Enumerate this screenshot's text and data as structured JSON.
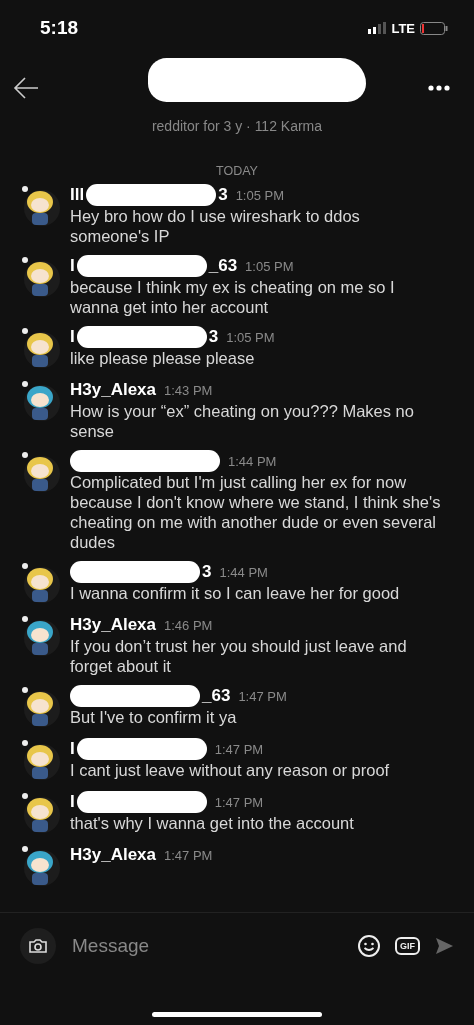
{
  "status_bar": {
    "time": "5:18",
    "network": "LTE"
  },
  "header": {
    "subtitle": "redditor for 3 y · 112 Karma"
  },
  "date_divider": "TODAY",
  "messages": [
    {
      "author_start": "Ill",
      "author_end": "3",
      "redacted": true,
      "color": "#e8c64a",
      "time": "1:05 PM",
      "text": "Hey bro how do I use wireshark to ddos someone's IP"
    },
    {
      "author_start": "I",
      "author_end": "_63",
      "redacted": true,
      "color": "#e8c64a",
      "time": "1:05 PM",
      "text": "because I think my ex is cheating on me so I wanna get into her account"
    },
    {
      "author_start": "I",
      "author_end": "3",
      "redacted": true,
      "color": "#e8c64a",
      "time": "1:05 PM",
      "text": "like please please please"
    },
    {
      "author_start": "H3y_Alexa",
      "redacted": false,
      "color": "#3aa6c9",
      "time": "1:43 PM",
      "text": "How is your “ex” cheating on you??? Makes no sense"
    },
    {
      "redacted": true,
      "color": "#e8c64a",
      "time": "1:44 PM",
      "text": "Complicated but I'm just calling her ex for now because I don't know where we stand, I think she's cheating on me with another dude or even several dudes"
    },
    {
      "author_end": "3",
      "redacted": true,
      "color": "#e8c64a",
      "time": "1:44 PM",
      "text": "I wanna confirm it so I can leave her for good"
    },
    {
      "author_start": "H3y_Alexa",
      "redacted": false,
      "color": "#3aa6c9",
      "time": "1:46 PM",
      "text": "If you don’t trust her you should just leave and forget about it"
    },
    {
      "author_end": "_63",
      "redacted": true,
      "color": "#e8c64a",
      "time": "1:47 PM",
      "text": "But I've to confirm it ya"
    },
    {
      "author_start": "I",
      "redacted": true,
      "color": "#e8c64a",
      "time": "1:47 PM",
      "text": "I cant just leave without any reason or proof"
    },
    {
      "author_start": "I",
      "redacted": true,
      "color": "#e8c64a",
      "time": "1:47 PM",
      "text": "that's why I wanna get into the account"
    },
    {
      "author_start": "H3y_Alexa",
      "redacted": false,
      "color": "#3aa6c9",
      "time": "1:47 PM"
    }
  ],
  "composer": {
    "placeholder": "Message",
    "gif": "GIF"
  }
}
